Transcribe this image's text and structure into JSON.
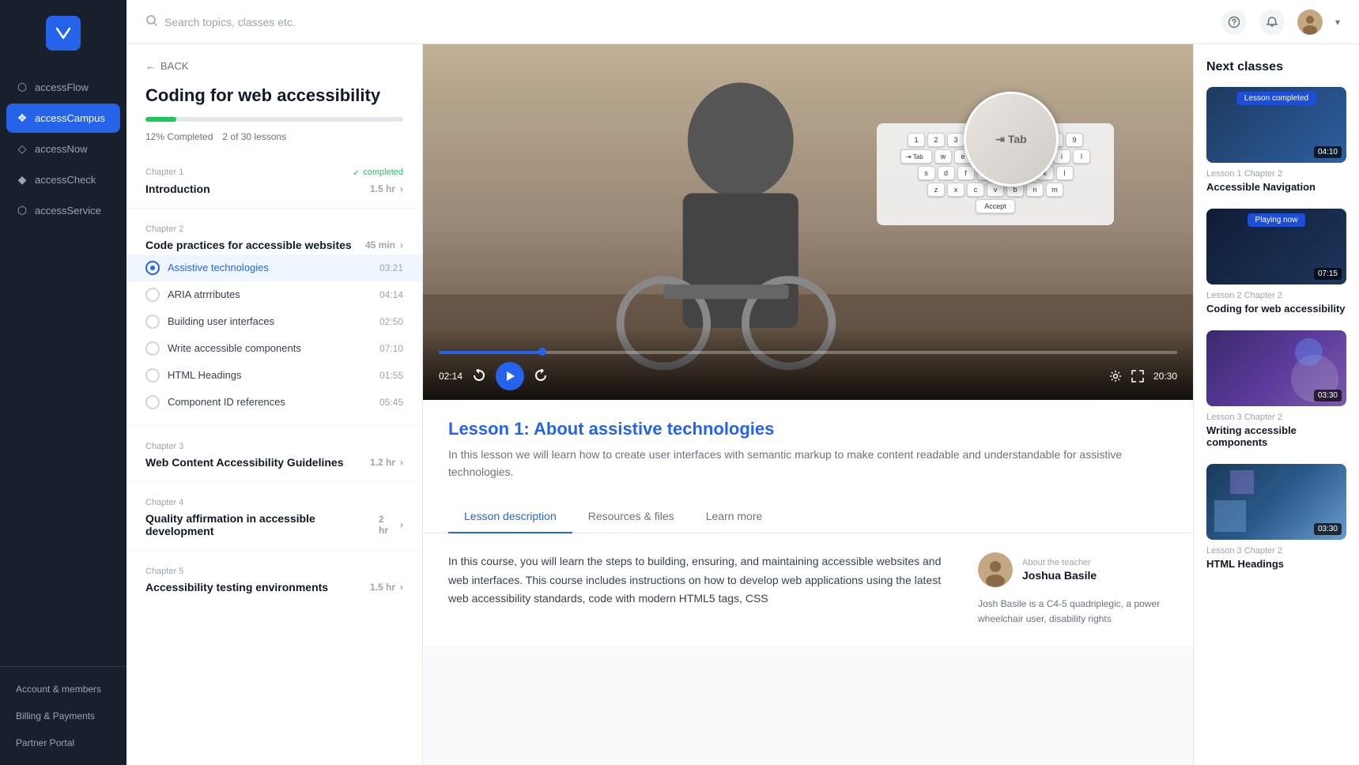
{
  "app": {
    "logo_text": "V"
  },
  "sidebar": {
    "items": [
      {
        "id": "accessflow",
        "label": "accessFlow",
        "icon": "◈"
      },
      {
        "id": "accesscampus",
        "label": "accessCampus",
        "icon": "❖",
        "active": true
      },
      {
        "id": "accessnow",
        "label": "accessNow",
        "icon": "◇"
      },
      {
        "id": "accesscheck",
        "label": "accessCheck",
        "icon": "◆"
      },
      {
        "id": "accessservice",
        "label": "accessService",
        "icon": "◈"
      }
    ],
    "bottom_items": [
      {
        "id": "account",
        "label": "Account & members"
      },
      {
        "id": "billing",
        "label": "Billing & Payments"
      },
      {
        "id": "partner",
        "label": "Partner Portal"
      }
    ]
  },
  "topbar": {
    "search_placeholder": "Search topics, classes etc."
  },
  "course": {
    "back_label": "BACK",
    "title": "Coding for web accessibility",
    "progress_percent": 12,
    "progress_label": "12% Completed",
    "lessons_label": "2 of 30 lessons",
    "chapters": [
      {
        "id": 1,
        "label": "Chapter 1",
        "name": "Introduction",
        "status": "completed",
        "duration": "1.5 hr",
        "lessons": []
      },
      {
        "id": 2,
        "label": "Chapter 2",
        "name": "Code practices for accessible websites",
        "duration": "45 min",
        "lessons": [
          {
            "id": "l1",
            "name": "Assistive technologies",
            "duration": "03:21",
            "active": true
          },
          {
            "id": "l2",
            "name": "ARIA atrrributes",
            "duration": "04:14"
          },
          {
            "id": "l3",
            "name": "Building user interfaces",
            "duration": "02:50"
          },
          {
            "id": "l4",
            "name": "Write accessible components",
            "duration": "07:10"
          },
          {
            "id": "l5",
            "name": "HTML Headings",
            "duration": "01:55"
          },
          {
            "id": "l6",
            "name": "Component ID references",
            "duration": "05:45"
          }
        ]
      },
      {
        "id": 3,
        "label": "Chapter 3",
        "name": "Web Content Accessibility Guidelines",
        "duration": "1.2 hr",
        "lessons": []
      },
      {
        "id": 4,
        "label": "Chapter 4",
        "name": "Quality affirmation in accessible development",
        "duration": "2 hr",
        "lessons": []
      },
      {
        "id": 5,
        "label": "Chapter 5",
        "name": "Accessibility testing environments",
        "duration": "1.5 hr",
        "lessons": []
      }
    ]
  },
  "video": {
    "current_time": "02:14",
    "total_time": "20:30"
  },
  "lesson": {
    "title": "Lesson 1: About assistive technologies",
    "description": "In this lesson we will learn how to create user interfaces with semantic markup to make content readable and understandable for assistive technologies.",
    "tabs": [
      {
        "id": "description",
        "label": "Lesson description",
        "active": true
      },
      {
        "id": "resources",
        "label": "Resources & files"
      },
      {
        "id": "learnmore",
        "label": "Learn more"
      }
    ],
    "body_text": "In this course, you will learn the steps to building, ensuring, and maintaining accessible websites and web interfaces. This course includes instructions on how to develop web applications using the latest web accessibility standards, code with modern HTML5 tags, CSS",
    "teacher": {
      "about_label": "About the teacher",
      "name": "Joshua Basile",
      "bio": "Josh Basile is a C4-5 quadriplegic, a power wheelchair user, disability rights"
    }
  },
  "next_classes": {
    "title": "Next classes",
    "items": [
      {
        "id": "nc1",
        "badge": "Lesson completed",
        "duration": "04:10",
        "meta": "Lesson 1 Chapter 2",
        "title": "Accessible Navigation",
        "thumb_style": "thumb-1"
      },
      {
        "id": "nc2",
        "badge": "Playing now",
        "duration": "07:15",
        "meta": "Lesson 2 Chapter 2",
        "title": "Coding for web accessibility",
        "thumb_style": "thumb-2"
      },
      {
        "id": "nc3",
        "duration": "03:30",
        "meta": "Lesson 3 Chapter 2",
        "title": "Writing accessible components",
        "thumb_style": "thumb-3"
      },
      {
        "id": "nc4",
        "duration": "03:30",
        "meta": "Lesson 3 Chapter 2",
        "title": "HTML Headings",
        "thumb_style": "thumb-4"
      }
    ]
  }
}
